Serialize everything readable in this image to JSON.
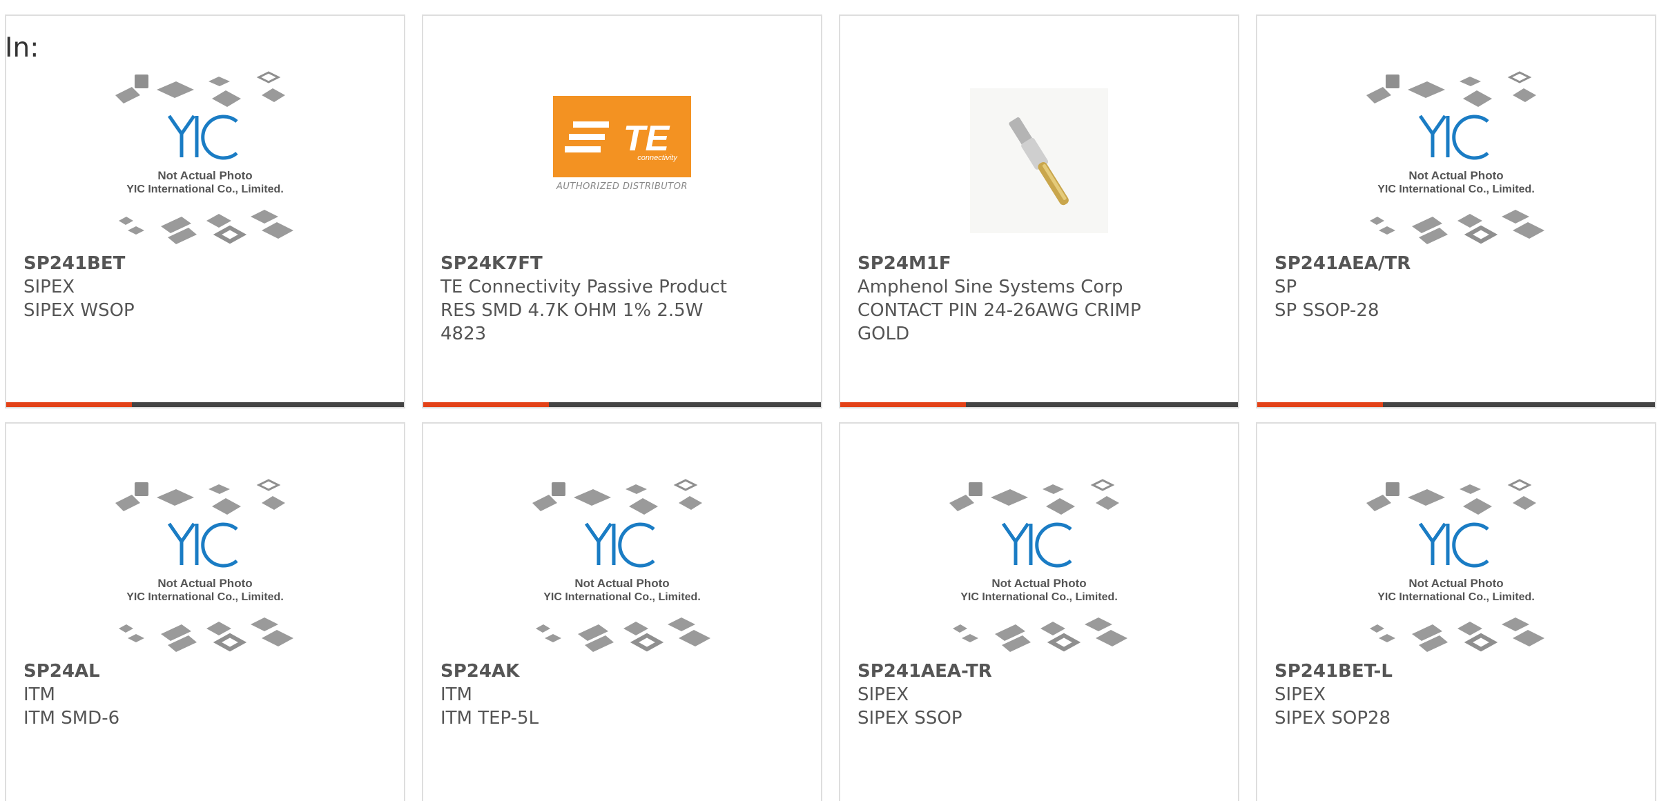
{
  "header": {
    "label": "In:"
  },
  "placeholder": {
    "line1": "Not Actual Photo",
    "line2": "YIC International Co., Limited."
  },
  "te_logo": {
    "text": "TE",
    "sub": "connectivity",
    "caption": "AUTHORIZED DISTRIBUTOR"
  },
  "colors": {
    "accent": "#e34218",
    "bar": "#444444",
    "te_orange": "#f39222",
    "yic_blue": "#1a7cc4"
  },
  "products": [
    {
      "part": "SP241BET",
      "maker": "SIPEX",
      "desc": "SIPEX WSOP",
      "image": "yic-placeholder",
      "bar": true
    },
    {
      "part": "SP24K7FT",
      "maker": "TE Connectivity Passive Product",
      "desc": "RES SMD 4.7K OHM 1% 2.5W 4823",
      "image": "te-logo",
      "bar": true
    },
    {
      "part": "SP24M1F",
      "maker": "Amphenol Sine Systems Corp",
      "desc": "CONTACT PIN 24-26AWG CRIMP GOLD",
      "image": "contact-pin",
      "bar": true
    },
    {
      "part": "SP241AEA/TR",
      "maker": "SP",
      "desc": "SP SSOP-28",
      "image": "yic-placeholder",
      "bar": true
    },
    {
      "part": "SP24AL",
      "maker": "ITM",
      "desc": "ITM SMD-6",
      "image": "yic-placeholder",
      "bar": false
    },
    {
      "part": "SP24AK",
      "maker": "ITM",
      "desc": "ITM TEP-5L",
      "image": "yic-placeholder",
      "bar": false
    },
    {
      "part": "SP241AEA-TR",
      "maker": "SIPEX",
      "desc": "SIPEX SSOP",
      "image": "yic-placeholder",
      "bar": false
    },
    {
      "part": "SP241BET-L",
      "maker": "SIPEX",
      "desc": "SIPEX SOP28",
      "image": "yic-placeholder",
      "bar": false
    }
  ]
}
